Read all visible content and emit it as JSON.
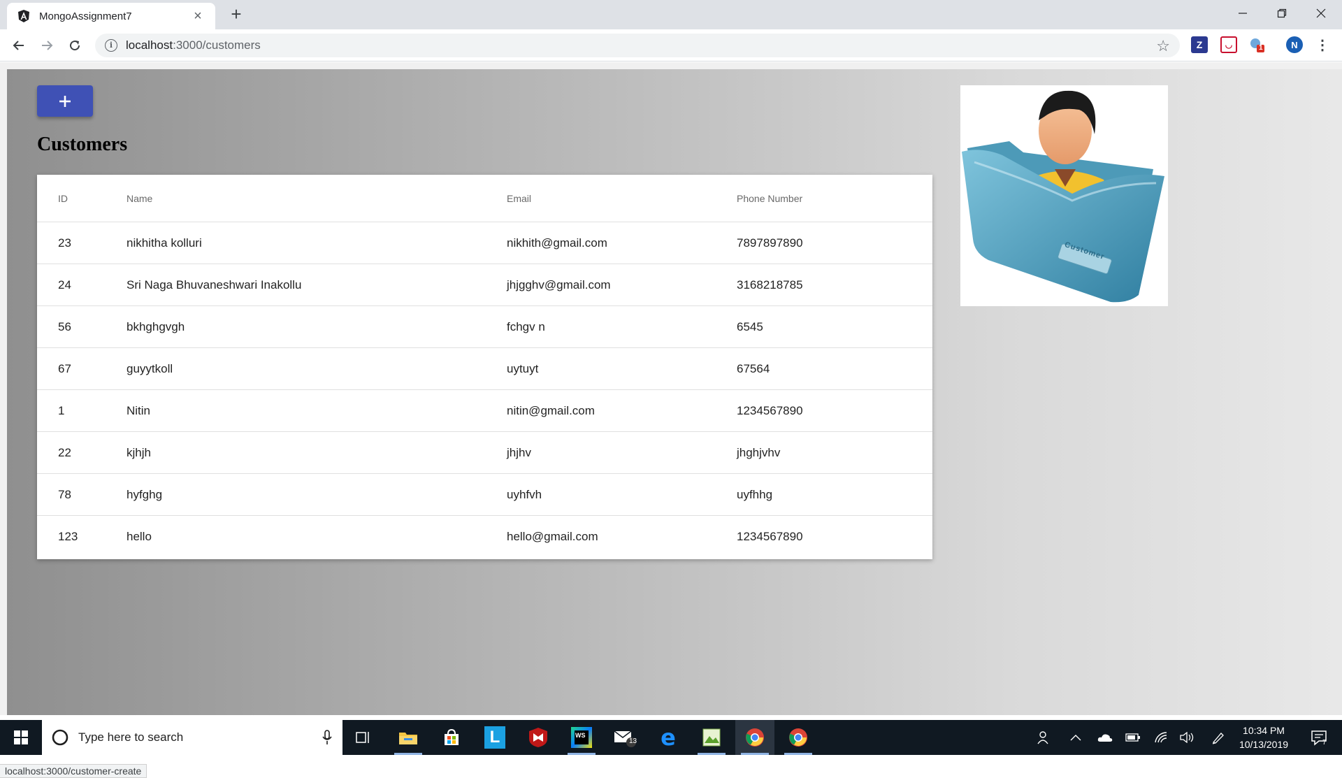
{
  "browser": {
    "tab_title": "MongoAssignment7",
    "url_host": "localhost",
    "url_path": ":3000/customers",
    "status_url": "localhost:3000/customer-create",
    "profile_initial": "N",
    "ext_badge": "1"
  },
  "page": {
    "add_button_label": "+",
    "title": "Customers",
    "columns": [
      "ID",
      "Name",
      "Email",
      "Phone Number"
    ],
    "rows": [
      {
        "id": "23",
        "name": "nikhitha kolluri",
        "email": "nikhith@gmail.com",
        "phone": "7897897890"
      },
      {
        "id": "24",
        "name": "Sri Naga Bhuvaneshwari Inakollu",
        "email": "jhjgghv@gmail.com",
        "phone": "3168218785"
      },
      {
        "id": "56",
        "name": "bkhghgvgh",
        "email": "fchgv n",
        "phone": "6545"
      },
      {
        "id": "67",
        "name": "guyytkoll",
        "email": "uytuyt",
        "phone": "67564"
      },
      {
        "id": "1",
        "name": "Nitin",
        "email": "nitin@gmail.com",
        "phone": "1234567890"
      },
      {
        "id": "22",
        "name": "kjhjh",
        "email": "jhjhv",
        "phone": "jhghjvhv"
      },
      {
        "id": "78",
        "name": "hyfghg",
        "email": "uyhfvh",
        "phone": "uyfhhg"
      },
      {
        "id": "123",
        "name": "hello",
        "email": "hello@gmail.com",
        "phone": "1234567890"
      }
    ],
    "image_folder_label": "Customer"
  },
  "taskbar": {
    "search_placeholder": "Type here to search",
    "time": "10:34 PM",
    "date": "10/13/2019",
    "mail_badge": "13",
    "notification_count": "7"
  },
  "colors": {
    "accent": "#3f51b5",
    "taskbar": "#101922"
  }
}
